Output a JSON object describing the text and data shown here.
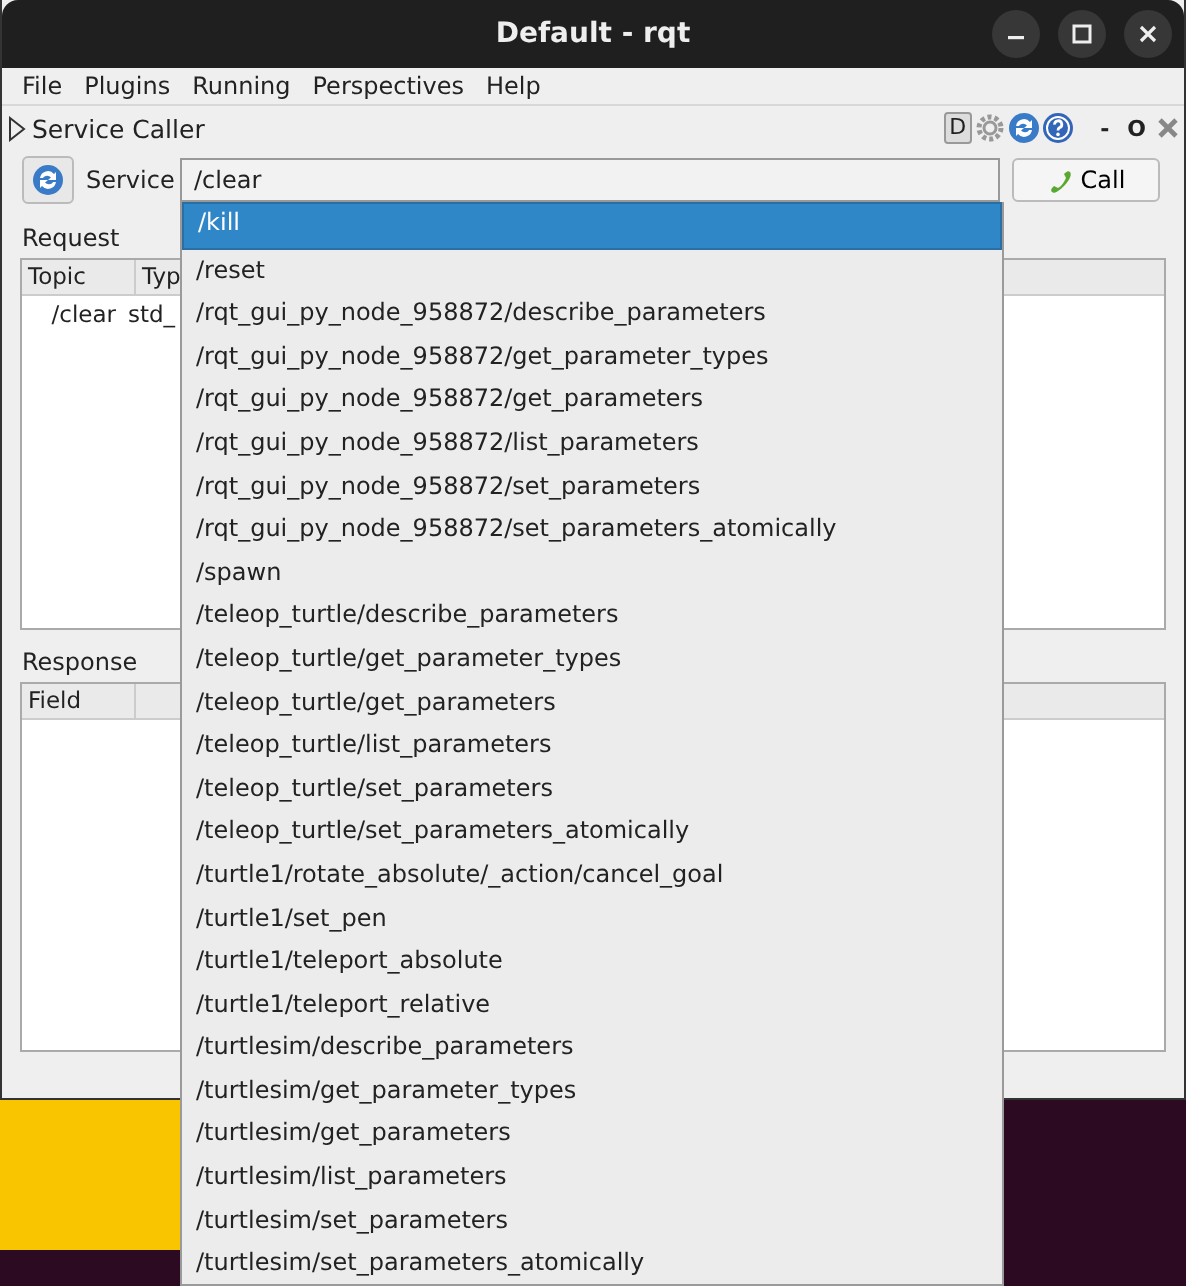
{
  "window": {
    "title": "Default - rqt"
  },
  "menu": [
    {
      "label": "File"
    },
    {
      "label": "Plugins"
    },
    {
      "label": "Running"
    },
    {
      "label": "Perspectives"
    },
    {
      "label": "Help"
    }
  ],
  "plugin": {
    "title": "Service Caller",
    "toolbar": [
      "D",
      "-",
      "O"
    ]
  },
  "service": {
    "label": "Service",
    "value": "/clear",
    "call_button": "Call"
  },
  "request": {
    "label": "Request",
    "columns": [
      "Topic",
      "Typ"
    ],
    "rows": [
      [
        "/clear",
        "std_"
      ]
    ]
  },
  "response": {
    "label": "Response",
    "columns": [
      "Field"
    ]
  },
  "dropdown": [
    {
      "label": "/kill",
      "selected": true
    },
    {
      "label": "/reset",
      "selected": false
    },
    {
      "label": "/rqt_gui_py_node_958872/describe_parameters",
      "selected": false
    },
    {
      "label": "/rqt_gui_py_node_958872/get_parameter_types",
      "selected": false
    },
    {
      "label": "/rqt_gui_py_node_958872/get_parameters",
      "selected": false
    },
    {
      "label": "/rqt_gui_py_node_958872/list_parameters",
      "selected": false
    },
    {
      "label": "/rqt_gui_py_node_958872/set_parameters",
      "selected": false
    },
    {
      "label": "/rqt_gui_py_node_958872/set_parameters_atomically",
      "selected": false
    },
    {
      "label": "/spawn",
      "selected": false
    },
    {
      "label": "/teleop_turtle/describe_parameters",
      "selected": false
    },
    {
      "label": "/teleop_turtle/get_parameter_types",
      "selected": false
    },
    {
      "label": "/teleop_turtle/get_parameters",
      "selected": false
    },
    {
      "label": "/teleop_turtle/list_parameters",
      "selected": false
    },
    {
      "label": "/teleop_turtle/set_parameters",
      "selected": false
    },
    {
      "label": "/teleop_turtle/set_parameters_atomically",
      "selected": false
    },
    {
      "label": "/turtle1/rotate_absolute/_action/cancel_goal",
      "selected": false
    },
    {
      "label": "/turtle1/set_pen",
      "selected": false
    },
    {
      "label": "/turtle1/teleport_absolute",
      "selected": false
    },
    {
      "label": "/turtle1/teleport_relative",
      "selected": false
    },
    {
      "label": "/turtlesim/describe_parameters",
      "selected": false
    },
    {
      "label": "/turtlesim/get_parameter_types",
      "selected": false
    },
    {
      "label": "/turtlesim/get_parameters",
      "selected": false
    },
    {
      "label": "/turtlesim/list_parameters",
      "selected": false
    },
    {
      "label": "/turtlesim/set_parameters",
      "selected": false
    },
    {
      "label": "/turtlesim/set_parameters_atomically",
      "selected": false
    }
  ]
}
